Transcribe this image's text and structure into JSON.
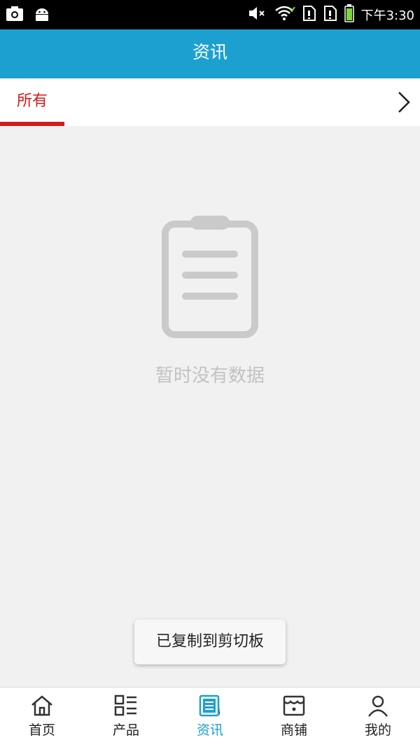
{
  "status_bar": {
    "time": "下午3:30",
    "left_icons": [
      "camera-icon",
      "android-icon"
    ],
    "right_icons": [
      "volume-mute-icon",
      "wifi-icon",
      "sim-alert-icon",
      "sim-alert-icon",
      "battery-icon"
    ]
  },
  "header": {
    "title": "资讯",
    "color": "#1ba0d0"
  },
  "tabs": {
    "active_label": "所有",
    "active_color": "#d21b1b",
    "more_icon": "chevron-right-icon"
  },
  "empty_state": {
    "icon": "clipboard-icon",
    "message": "暂时没有数据"
  },
  "toast": {
    "message": "已复制到剪切板"
  },
  "bottom_nav": {
    "items": [
      {
        "label": "首页",
        "icon": "home-icon",
        "active": false
      },
      {
        "label": "产品",
        "icon": "list-grid-icon",
        "active": false
      },
      {
        "label": "资讯",
        "icon": "document-icon",
        "active": true
      },
      {
        "label": "商铺",
        "icon": "store-icon",
        "active": false
      },
      {
        "label": "我的",
        "icon": "user-icon",
        "active": false
      }
    ]
  }
}
